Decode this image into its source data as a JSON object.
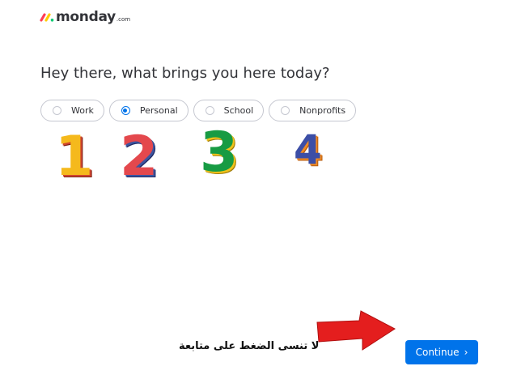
{
  "brand": {
    "name": "monday",
    "suffix": ".com",
    "dot_colors": [
      "#ff3d57",
      "#ffcb00",
      "#00ca72"
    ]
  },
  "question": "Hey there, what brings you here today?",
  "options": [
    {
      "label": "Work",
      "selected": false
    },
    {
      "label": "Personal",
      "selected": true
    },
    {
      "label": "School",
      "selected": false
    },
    {
      "label": "Nonprofits",
      "selected": false
    }
  ],
  "annotations": {
    "numbers": [
      "1",
      "2",
      "3",
      "4"
    ],
    "hint_text": "لا تنسى الضغط على متابعة",
    "arrow_color": "#e41e1e"
  },
  "continue_button": {
    "label": "Continue",
    "icon": "chevron-right-icon",
    "glyph": "›",
    "color": "#0073ea"
  }
}
